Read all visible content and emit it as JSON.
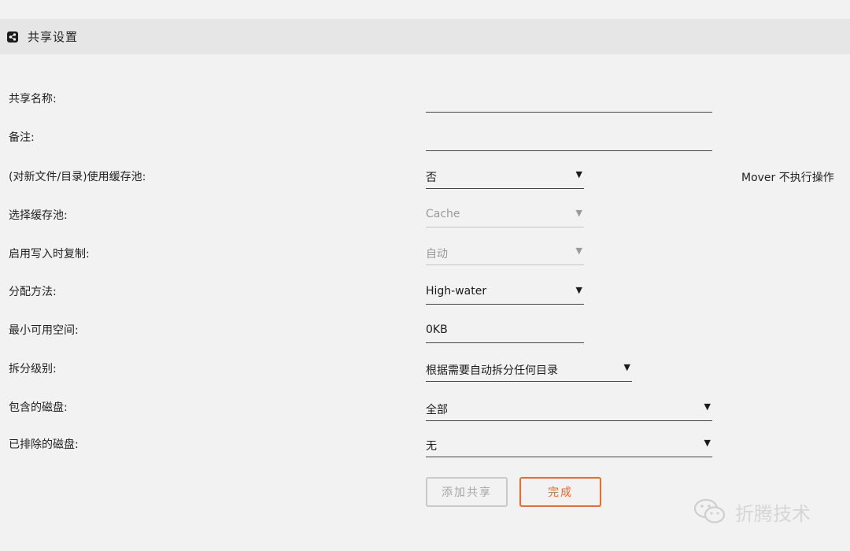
{
  "header": {
    "title": "共享设置",
    "icon": "share-icon"
  },
  "form": {
    "share_name": {
      "label": "共享名称:",
      "value": ""
    },
    "comment": {
      "label": "备注:",
      "value": ""
    },
    "use_cache": {
      "label": "(对新文件/目录)使用缓存池:",
      "value": "否",
      "note": "Mover 不执行操作"
    },
    "cache_pool": {
      "label": "选择缓存池:",
      "value": "Cache"
    },
    "cow": {
      "label": "启用写入时复制:",
      "value": "自动"
    },
    "allocation": {
      "label": "分配方法:",
      "value": "High-water"
    },
    "min_free": {
      "label": "最小可用空间:",
      "value": "0KB"
    },
    "split_level": {
      "label": "拆分级别:",
      "value": "根据需要自动拆分任何目录"
    },
    "included_disks": {
      "label": "包含的磁盘:",
      "value": "全部"
    },
    "excluded_disks": {
      "label": "已排除的磁盘:",
      "value": "无"
    }
  },
  "buttons": {
    "add_share": "添加共享",
    "done": "完成"
  },
  "watermark": {
    "text": "折腾技术"
  },
  "colors": {
    "accent": "#ef6a2c",
    "header_bg": "#e6e6e6",
    "page_bg": "#f2f2f2"
  }
}
